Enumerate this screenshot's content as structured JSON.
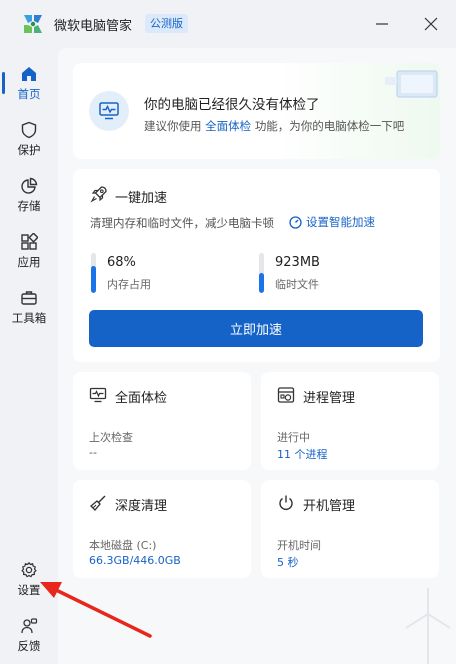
{
  "app": {
    "title": "微软电脑管家",
    "badge": "公测版"
  },
  "sidebar": {
    "items": [
      {
        "label": "首页",
        "icon": "home-icon"
      },
      {
        "label": "保护",
        "icon": "shield-icon"
      },
      {
        "label": "存储",
        "icon": "pie-chart-icon"
      },
      {
        "label": "应用",
        "icon": "apps-icon"
      },
      {
        "label": "工具箱",
        "icon": "toolbox-icon"
      }
    ],
    "bottom": [
      {
        "label": "设置",
        "icon": "gear-icon"
      },
      {
        "label": "反馈",
        "icon": "feedback-icon"
      }
    ]
  },
  "banner": {
    "title": "你的电脑已经很久没有体检了",
    "desc_prefix": "建议你使用",
    "desc_link": "全面体检",
    "desc_suffix": "功能，为你的电脑体检一下吧"
  },
  "speedup": {
    "title": "一键加速",
    "desc": "清理内存和临时文件，减少电脑卡顿",
    "smart_link": "设置智能加速",
    "memory": {
      "value": "68%",
      "label": "内存占用",
      "fill": 68
    },
    "temp": {
      "value": "923MB",
      "label": "临时文件",
      "fill": 50
    },
    "button": "立即加速"
  },
  "tiles": {
    "checkup": {
      "title": "全面体检",
      "key": "上次检查",
      "value": "--"
    },
    "process": {
      "title": "进程管理",
      "key": "进行中",
      "value": "11 个进程"
    },
    "cleanup": {
      "title": "深度清理",
      "key": "本地磁盘 (C:)",
      "value": "66.3GB/446.0GB"
    },
    "startup": {
      "title": "开机管理",
      "key": "开机时间",
      "value": "5 秒"
    }
  },
  "colors": {
    "accent": "#1663c7",
    "annotation_arrow": "#e8261c"
  }
}
